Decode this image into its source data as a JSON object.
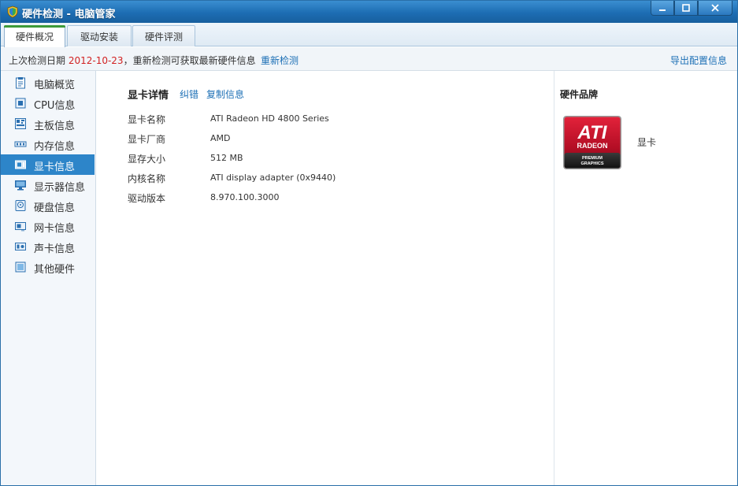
{
  "window": {
    "title": "硬件检测 - 电脑管家"
  },
  "tabs": [
    {
      "label": "硬件概况",
      "active": true
    },
    {
      "label": "驱动安装",
      "active": false
    },
    {
      "label": "硬件评测",
      "active": false
    }
  ],
  "infobar": {
    "prefix": "上次检测日期 ",
    "date": "2012-10-23",
    "suffix": "，重新检测可获取最新硬件信息",
    "recheck_link": "重新检测",
    "export_link": "导出配置信息"
  },
  "sidebar": {
    "items": [
      {
        "label": "电脑概览",
        "icon": "clipboard-icon",
        "active": false
      },
      {
        "label": "CPU信息",
        "icon": "cpu-icon",
        "active": false
      },
      {
        "label": "主板信息",
        "icon": "motherboard-icon",
        "active": false
      },
      {
        "label": "内存信息",
        "icon": "memory-icon",
        "active": false
      },
      {
        "label": "显卡信息",
        "icon": "graphics-card-icon",
        "active": true
      },
      {
        "label": "显示器信息",
        "icon": "monitor-icon",
        "active": false
      },
      {
        "label": "硬盘信息",
        "icon": "hard-disk-icon",
        "active": false
      },
      {
        "label": "网卡信息",
        "icon": "network-card-icon",
        "active": false
      },
      {
        "label": "声卡信息",
        "icon": "sound-card-icon",
        "active": false
      },
      {
        "label": "其他硬件",
        "icon": "other-hardware-icon",
        "active": false
      }
    ]
  },
  "details": {
    "title": "显卡详情",
    "correct_link": "纠错",
    "copy_link": "复制信息",
    "rows": [
      {
        "key": "显卡名称",
        "value": "ATI Radeon HD 4800 Series"
      },
      {
        "key": "显卡厂商",
        "value": "AMD"
      },
      {
        "key": "显存大小",
        "value": "512 MB"
      },
      {
        "key": "内核名称",
        "value": "ATI display adapter (0x9440)"
      },
      {
        "key": "驱动版本",
        "value": "8.970.100.3000"
      }
    ]
  },
  "brand": {
    "title": "硬件品牌",
    "caption": "显卡",
    "logo_text": {
      "top": "ATI",
      "middle": "RADEON",
      "bottom1": "PREMIUM",
      "bottom2": "GRAPHICS"
    }
  },
  "colors": {
    "titlebar": "#1d6db3",
    "accent_link": "#1c6fb5",
    "date_red": "#d22222",
    "active_nav": "#2d85c9",
    "active_tab_marker": "#3d9a3a",
    "ati_red": "#c8102e"
  }
}
